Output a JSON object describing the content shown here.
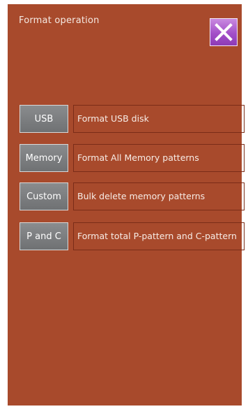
{
  "screen": {
    "title": "Format operation",
    "close_icon": "close-x-icon",
    "colors": {
      "background": "#a84a2c",
      "button": "#7c7e80",
      "close_button": "#a34fc8",
      "text": "#f5e9e2"
    }
  },
  "options": [
    {
      "button_label": "USB",
      "description": "Format USB disk"
    },
    {
      "button_label": "Memory",
      "description": "Format All Memory patterns"
    },
    {
      "button_label": "Custom",
      "description": "Bulk delete memory patterns"
    },
    {
      "button_label": "P and C",
      "description": "Format total P-pattern and C-pattern"
    }
  ]
}
